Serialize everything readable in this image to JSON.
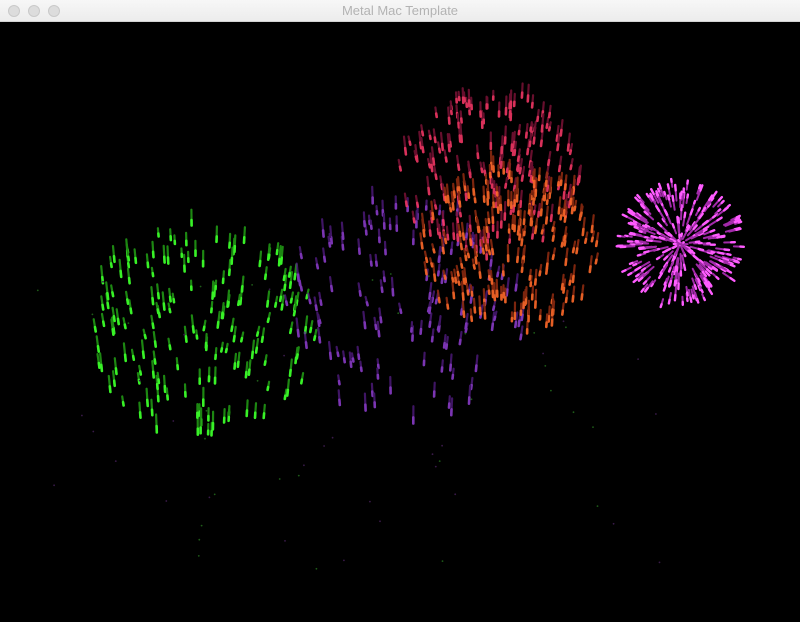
{
  "window": {
    "title": "Metal Mac Template"
  },
  "scene": {
    "background": "#000000",
    "bursts": [
      {
        "name": "green-firework",
        "color": "#3cff2a",
        "trail": "#1f8f14"
      },
      {
        "name": "purple-firework",
        "color": "#b04cff",
        "trail": "#5a1f8f"
      },
      {
        "name": "crimson-firework",
        "color": "#ff3a6a",
        "trail": "#7a1236"
      },
      {
        "name": "orange-firework",
        "color": "#ff6a2a",
        "trail": "#8a2a10"
      },
      {
        "name": "magenta-firework",
        "color": "#ff5cff",
        "trail": "#a12aa8"
      }
    ]
  }
}
